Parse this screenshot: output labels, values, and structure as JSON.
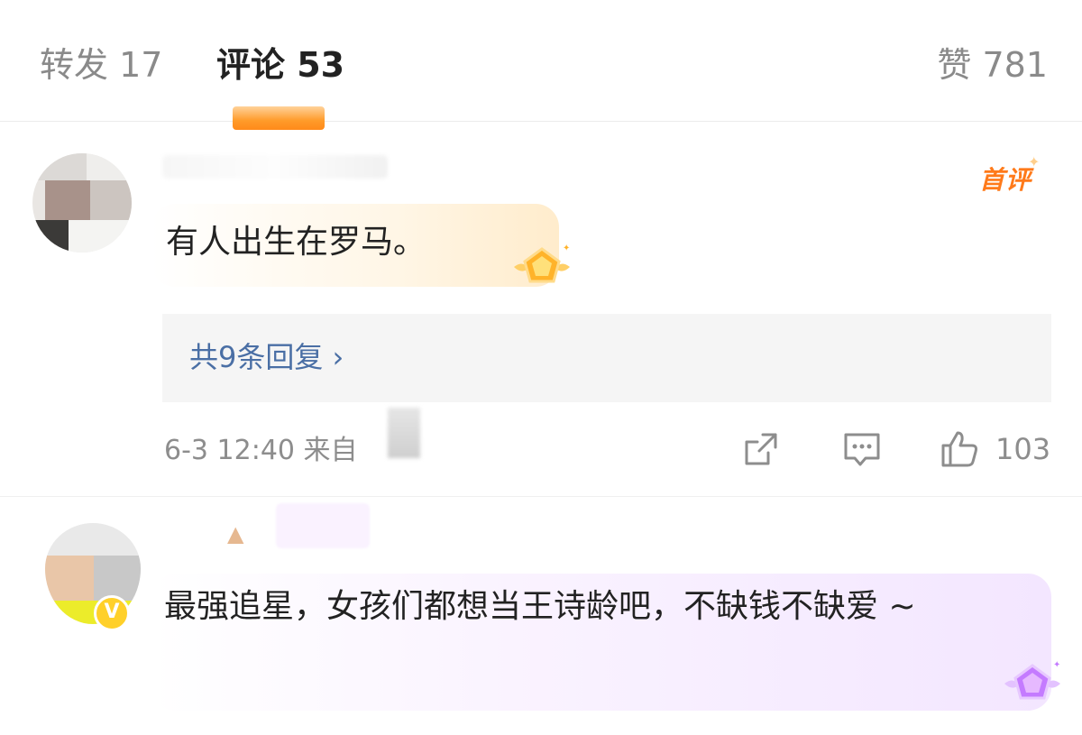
{
  "tabs": {
    "repost": "转发 17",
    "comments": "评论 53",
    "likes": "赞 781"
  },
  "comments": [
    {
      "badge": "首评",
      "text": "有人出生在罗马。",
      "replies_link": "共9条回复 ›",
      "meta": "6-3 12:40  来自",
      "like_count": "103"
    },
    {
      "text": "最强追星，女孩们都想当王诗龄吧，不缺钱不缺爱 ~"
    }
  ],
  "colors": {
    "accent_orange": "#ff8a1a",
    "link_blue": "#4a6fa5",
    "muted_gray": "#8d8d8d"
  },
  "icons": [
    "share-icon",
    "comment-icon",
    "thumbs-up-icon",
    "chevron-right-icon",
    "gem-badge-icon",
    "vip-badge-icon"
  ]
}
